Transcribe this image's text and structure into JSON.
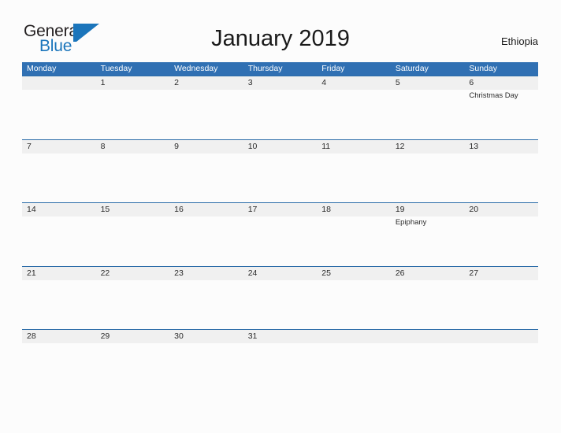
{
  "brand": {
    "name_part1": "General",
    "name_part2": "Blue",
    "logo_icon": "blue-flag-triangle-icon",
    "color_dark": "#231f20",
    "color_blue": "#1b75bb"
  },
  "header": {
    "title": "January 2019",
    "country": "Ethiopia"
  },
  "theme": {
    "header_blue": "#3070b3",
    "band_grey": "#f0f0f0",
    "band_rule": "#2b6ca8",
    "page_background": "#fcfcfc",
    "text_color": "#2b2b2b"
  },
  "calendar": {
    "month": "January",
    "year": "2019",
    "weekdays": [
      "Monday",
      "Tuesday",
      "Wednesday",
      "Thursday",
      "Friday",
      "Saturday",
      "Sunday"
    ],
    "weeks": [
      [
        {
          "day": "",
          "event": ""
        },
        {
          "day": "1",
          "event": ""
        },
        {
          "day": "2",
          "event": ""
        },
        {
          "day": "3",
          "event": ""
        },
        {
          "day": "4",
          "event": ""
        },
        {
          "day": "5",
          "event": ""
        },
        {
          "day": "6",
          "event": "Christmas Day"
        }
      ],
      [
        {
          "day": "7",
          "event": ""
        },
        {
          "day": "8",
          "event": ""
        },
        {
          "day": "9",
          "event": ""
        },
        {
          "day": "10",
          "event": ""
        },
        {
          "day": "11",
          "event": ""
        },
        {
          "day": "12",
          "event": ""
        },
        {
          "day": "13",
          "event": ""
        }
      ],
      [
        {
          "day": "14",
          "event": ""
        },
        {
          "day": "15",
          "event": ""
        },
        {
          "day": "16",
          "event": ""
        },
        {
          "day": "17",
          "event": ""
        },
        {
          "day": "18",
          "event": ""
        },
        {
          "day": "19",
          "event": "Epiphany"
        },
        {
          "day": "20",
          "event": ""
        }
      ],
      [
        {
          "day": "21",
          "event": ""
        },
        {
          "day": "22",
          "event": ""
        },
        {
          "day": "23",
          "event": ""
        },
        {
          "day": "24",
          "event": ""
        },
        {
          "day": "25",
          "event": ""
        },
        {
          "day": "26",
          "event": ""
        },
        {
          "day": "27",
          "event": ""
        }
      ],
      [
        {
          "day": "28",
          "event": ""
        },
        {
          "day": "29",
          "event": ""
        },
        {
          "day": "30",
          "event": ""
        },
        {
          "day": "31",
          "event": ""
        },
        {
          "day": "",
          "event": ""
        },
        {
          "day": "",
          "event": ""
        },
        {
          "day": "",
          "event": ""
        }
      ]
    ],
    "holidays": [
      {
        "date": "6",
        "name": "Christmas Day"
      },
      {
        "date": "19",
        "name": "Epiphany"
      }
    ]
  }
}
